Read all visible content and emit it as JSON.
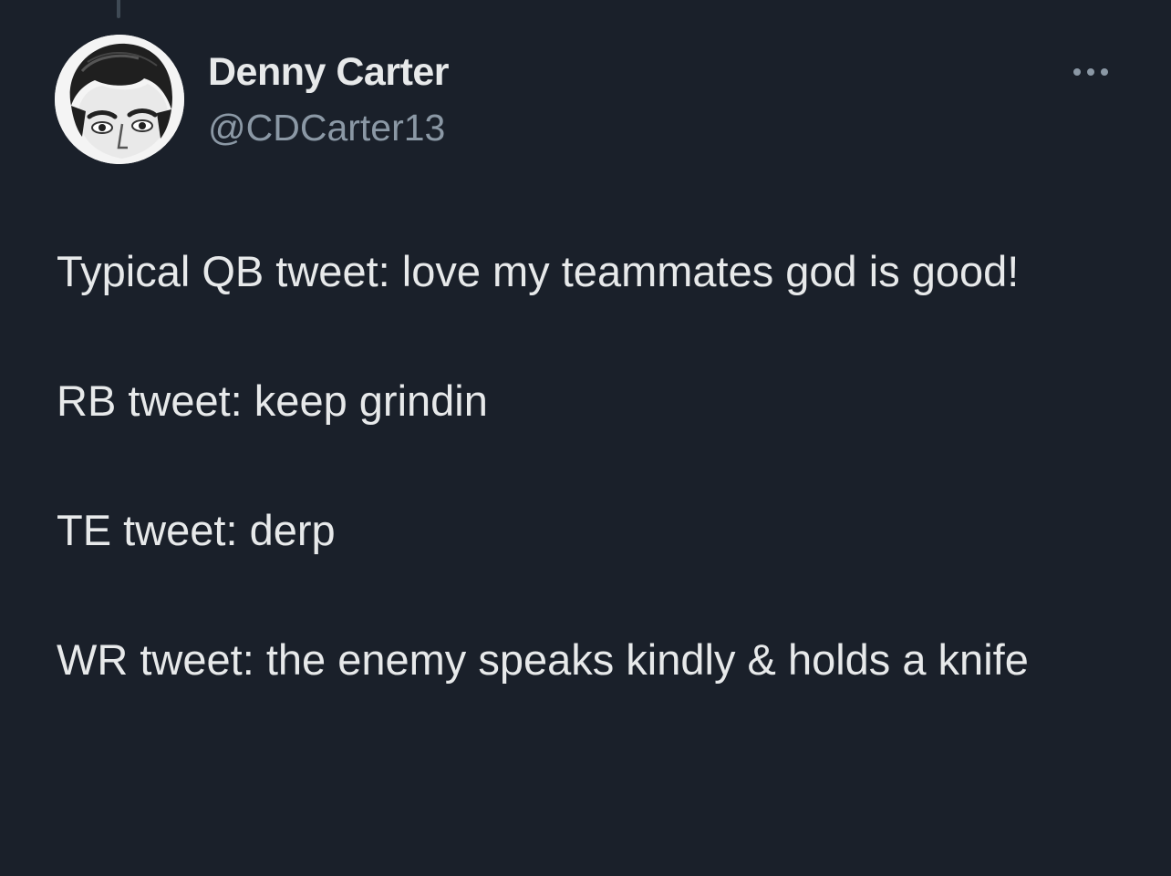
{
  "author": {
    "display_name": "Denny Carter",
    "handle": "@CDCarter13"
  },
  "tweet": {
    "paragraphs": [
      "Typical QB tweet: love my teammates god is good!",
      "RB tweet: keep grindin",
      "TE tweet: derp",
      "WR tweet: the enemy speaks kindly & holds a knife"
    ]
  },
  "icons": {
    "more": "more-horizontal-icon",
    "avatar": "caricature-avatar"
  },
  "colors": {
    "background": "#1a202a",
    "primary_text": "#e7e9ea",
    "secondary_text": "#8b98a5"
  }
}
